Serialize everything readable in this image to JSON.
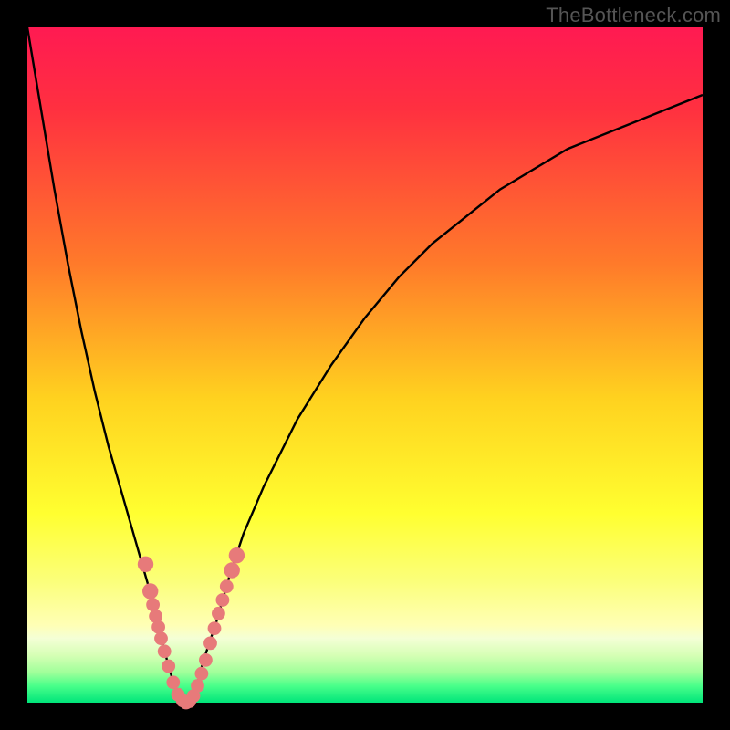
{
  "watermark": "TheBottleneck.com",
  "colors": {
    "frame": "#000000",
    "curve": "#000000",
    "marker_fill": "#e77a7a",
    "marker_stroke": "#d05757",
    "gradient_stops": [
      {
        "offset": 0.0,
        "color": "#ff1a52"
      },
      {
        "offset": 0.12,
        "color": "#ff3040"
      },
      {
        "offset": 0.35,
        "color": "#ff7a2a"
      },
      {
        "offset": 0.55,
        "color": "#ffd21f"
      },
      {
        "offset": 0.72,
        "color": "#ffff30"
      },
      {
        "offset": 0.82,
        "color": "#fbff7a"
      },
      {
        "offset": 0.885,
        "color": "#ffffb5"
      },
      {
        "offset": 0.905,
        "color": "#f4ffd6"
      },
      {
        "offset": 0.93,
        "color": "#d6ffb5"
      },
      {
        "offset": 0.955,
        "color": "#a0ff9a"
      },
      {
        "offset": 0.975,
        "color": "#4aff8a"
      },
      {
        "offset": 1.0,
        "color": "#00e57a"
      }
    ]
  },
  "chart_data": {
    "type": "line",
    "title": "",
    "xlabel": "",
    "ylabel": "",
    "xlim": [
      0,
      100
    ],
    "ylim": [
      0,
      100
    ],
    "x": [
      0,
      2,
      4,
      6,
      8,
      10,
      12,
      14,
      16,
      18,
      19,
      20,
      21,
      22,
      23,
      24,
      25,
      26,
      28,
      30,
      32,
      35,
      40,
      45,
      50,
      55,
      60,
      65,
      70,
      75,
      80,
      85,
      90,
      95,
      100
    ],
    "values": [
      100,
      88,
      76,
      65,
      55,
      46,
      38,
      31,
      24,
      17,
      13,
      9,
      5,
      2,
      0,
      0,
      2,
      6,
      12,
      19,
      25,
      32,
      42,
      50,
      57,
      63,
      68,
      72,
      76,
      79,
      82,
      84,
      86,
      88,
      90
    ],
    "minimum_x": 23.5,
    "markers": [
      {
        "x": 17.5,
        "y": 20.5,
        "r": 1.4
      },
      {
        "x": 18.2,
        "y": 16.5,
        "r": 1.4
      },
      {
        "x": 18.6,
        "y": 14.5,
        "r": 1.2
      },
      {
        "x": 19.0,
        "y": 12.8,
        "r": 1.2
      },
      {
        "x": 19.4,
        "y": 11.2,
        "r": 1.2
      },
      {
        "x": 19.8,
        "y": 9.5,
        "r": 1.2
      },
      {
        "x": 20.3,
        "y": 7.6,
        "r": 1.2
      },
      {
        "x": 20.9,
        "y": 5.4,
        "r": 1.2
      },
      {
        "x": 21.6,
        "y": 3.0,
        "r": 1.2
      },
      {
        "x": 22.3,
        "y": 1.2,
        "r": 1.2
      },
      {
        "x": 23.0,
        "y": 0.3,
        "r": 1.2
      },
      {
        "x": 23.5,
        "y": 0.0,
        "r": 1.2
      },
      {
        "x": 24.0,
        "y": 0.2,
        "r": 1.2
      },
      {
        "x": 24.6,
        "y": 1.0,
        "r": 1.2
      },
      {
        "x": 25.2,
        "y": 2.5,
        "r": 1.2
      },
      {
        "x": 25.8,
        "y": 4.3,
        "r": 1.2
      },
      {
        "x": 26.4,
        "y": 6.3,
        "r": 1.2
      },
      {
        "x": 27.1,
        "y": 8.8,
        "r": 1.2
      },
      {
        "x": 27.7,
        "y": 11.0,
        "r": 1.2
      },
      {
        "x": 28.3,
        "y": 13.2,
        "r": 1.2
      },
      {
        "x": 28.9,
        "y": 15.2,
        "r": 1.2
      },
      {
        "x": 29.5,
        "y": 17.2,
        "r": 1.2
      },
      {
        "x": 30.3,
        "y": 19.6,
        "r": 1.4
      },
      {
        "x": 31.0,
        "y": 21.8,
        "r": 1.4
      }
    ]
  }
}
